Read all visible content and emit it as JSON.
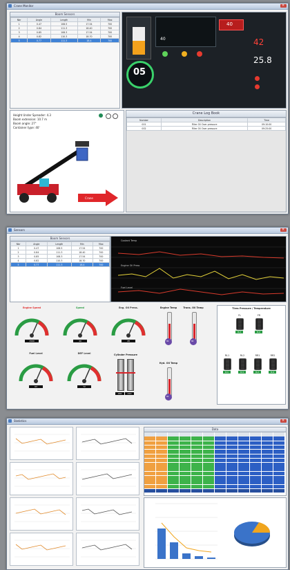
{
  "window1": {
    "title": "Crane Monitor",
    "boom_table": {
      "title": "Boom Sensors",
      "headers": [
        "Nbr",
        "Angle",
        "Length",
        "Min",
        "Max"
      ],
      "rows": [
        [
          "1",
          "0.47",
          "108.5",
          "17.54",
          "700"
        ],
        [
          "2",
          "0.84",
          "111.3",
          "18.40",
          "700"
        ],
        [
          "3",
          "0.85",
          "108.3",
          "17.54",
          "700"
        ],
        [
          "4",
          "0.82",
          "110.3",
          "18.70",
          "700"
        ],
        [
          "5",
          "0.77",
          "111.3",
          "18.4",
          "700"
        ]
      ],
      "selected_row": 4
    },
    "dashboard": {
      "speed": "05",
      "gear": "40",
      "right_value_top": "42",
      "right_value_main": "25.8",
      "red_box": "40"
    },
    "info": {
      "height_line": "Height Under Spreader: 4.3",
      "extension_line": "Boom extension: 10.7 m",
      "angle_line": "Boom angle: 27°",
      "container_line": "Container type: 40'"
    },
    "arrow_label": "Crane",
    "logbox": {
      "title": "Crane Log Book",
      "headers": [
        "Number",
        "Description",
        "Time"
      ],
      "rows": [
        [
          "001",
          "Filter Oil Over pressure",
          "09:10:00"
        ],
        [
          "002",
          "Filter Oil Over pressure",
          "09:25:00"
        ]
      ]
    }
  },
  "window2": {
    "title": "Sensors",
    "table": {
      "title": "Boom Sensors",
      "headers": [
        "Nbr",
        "Angle",
        "Length",
        "Min",
        "Max"
      ],
      "rows": [
        [
          "1",
          "0.47",
          "108.5",
          "17.54",
          "700"
        ],
        [
          "2",
          "0.84",
          "111.3",
          "18.40",
          "700"
        ],
        [
          "3",
          "0.85",
          "108.3",
          "17.54",
          "700"
        ],
        [
          "4",
          "0.82",
          "110.3",
          "18.70",
          "700"
        ],
        [
          "5",
          "0.77",
          "111.3",
          "18.4",
          "700"
        ]
      ],
      "selected_row": 4
    },
    "trend_labels": {
      "top": "Coolant Temp",
      "mid": "Engine Oil Press",
      "bottom": "Fuel Level"
    },
    "gauges": [
      {
        "label": "Engine Speed",
        "value": "1500",
        "color": "#e03030"
      },
      {
        "label": "Speed",
        "value": "40",
        "color": "#2a9c44"
      },
      {
        "label": "Eng. Oil Press.",
        "value": "28",
        "color": "#333333"
      },
      {
        "label": "Fuel Level",
        "value": "63",
        "color": "#333333"
      },
      {
        "label": "DEF Level",
        "value": "72",
        "color": "#333333"
      }
    ],
    "thermometers": [
      {
        "label": "Engine Temp",
        "value": "86"
      },
      {
        "label": "Trans. Oil Temp",
        "value": "80"
      },
      {
        "label": "Hyd. Oil Temp",
        "value": "60"
      }
    ],
    "cylinder": {
      "label": "Cylinder Pressure",
      "left": "180",
      "right": "210"
    },
    "tires": {
      "title": "Tires Pressure / Temperature",
      "front": [
        {
          "name": "FL",
          "value": "8.2"
        },
        {
          "name": "FR",
          "value": "8.2"
        }
      ],
      "rear": [
        {
          "name": "RL1",
          "value": "8.1"
        },
        {
          "name": "RL2",
          "value": "8.3"
        },
        {
          "name": "RR1",
          "value": "8.2"
        },
        {
          "name": "RR2",
          "value": "8.0"
        }
      ]
    }
  },
  "window3": {
    "title": "Statistics",
    "sheet_title": "Data",
    "pie_legend": [
      "A",
      "B"
    ]
  },
  "chart_data": {
    "type": "bar",
    "categories": [
      "1",
      "2",
      "3",
      "4",
      "5"
    ],
    "values": [
      22,
      12,
      4,
      2,
      1
    ],
    "ylim": [
      0,
      40
    ],
    "grid": true
  },
  "colors": {
    "accent_blue": "#3f82d6",
    "alarm_red": "#e03030",
    "ok_green": "#2a9c44"
  }
}
